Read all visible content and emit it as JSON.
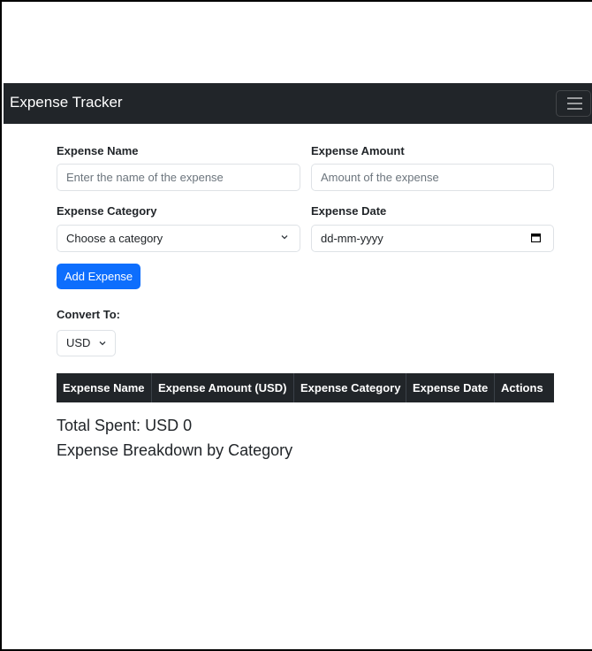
{
  "navbar": {
    "brand": "Expense Tracker",
    "toggler_icon": "hamburger-icon"
  },
  "form": {
    "name_label": "Expense Name",
    "name_placeholder": "Enter the name of the expense",
    "amount_label": "Expense Amount",
    "amount_placeholder": "Amount of the expense",
    "category_label": "Expense Category",
    "category_selected": "Choose a category",
    "date_label": "Expense Date",
    "date_placeholder": "dd-mm-yyyy",
    "add_button": "Add Expense"
  },
  "convert": {
    "label": "Convert To:",
    "selected": "USD"
  },
  "table": {
    "headers": [
      "Expense Name",
      "Expense Amount (USD)",
      "Expense Category",
      "Expense Date",
      "Actions"
    ]
  },
  "summary": {
    "total": "Total Spent: USD 0",
    "breakdown": "Expense Breakdown by Category"
  },
  "colors": {
    "navbar_bg": "#212529",
    "primary": "#0d6efd"
  }
}
